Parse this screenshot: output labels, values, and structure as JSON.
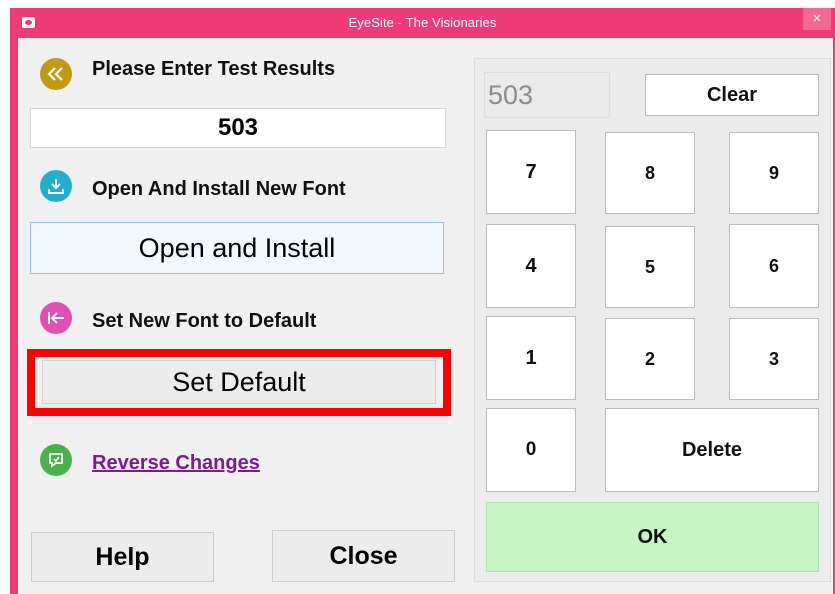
{
  "window": {
    "title": "EyeSite - The Visionaries",
    "close_glyph": "×"
  },
  "left": {
    "test_results_label": "Please Enter Test Results",
    "test_results_value": "503",
    "install_label": "Open And Install New Font",
    "install_button": "Open and Install",
    "default_label": "Set New Font to Default",
    "default_button": "Set Default",
    "reverse_link": "Reverse Changes",
    "help_button": "Help",
    "close_button": "Close"
  },
  "keypad": {
    "display": "503",
    "clear": "Clear",
    "keys": [
      "7",
      "8",
      "9",
      "4",
      "5",
      "6",
      "1",
      "2",
      "3",
      "0"
    ],
    "delete": "Delete",
    "ok": "OK"
  },
  "colors": {
    "frame": "#ef3a78",
    "back_icon": "#c19a13",
    "download_icon": "#21b0c9",
    "set_default_icon": "#e04fb1",
    "reverse_icon": "#47b24a",
    "highlight": "#ff0000",
    "ok_bg": "#c6f5c3",
    "link": "#7a1a9a"
  },
  "icons": [
    "back-chevrons-icon",
    "download-icon",
    "arrow-to-left-icon",
    "reverse-chat-icon",
    "app-eye-icon",
    "close-icon"
  ]
}
